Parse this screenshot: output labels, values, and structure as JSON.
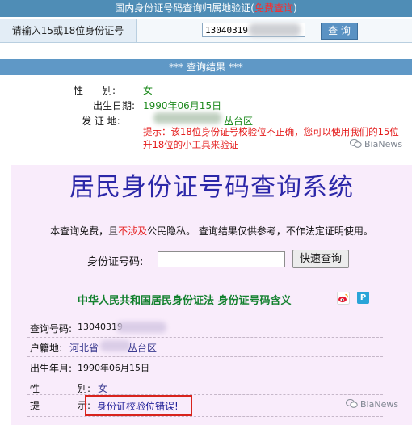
{
  "top_panel": {
    "title_prefix": "国内身份证号码查询归属地验证(",
    "title_badge": "免费查询",
    "title_suffix": ")",
    "input_label": "请输入15或18位身份证号",
    "input_value": "13040319",
    "query_button": "查 询",
    "result_bar": "*** 查询结果 ***",
    "gender_label": "性　　别:",
    "gender_value": "女",
    "birth_label": "出生日期:",
    "birth_value": "1990年06月15日",
    "issue_label": "发 证 地:",
    "issue_value_suffix": "丛台区",
    "hint_line1": "提示：该18位身份证号校验位不正确，您可以使用我们的15位",
    "hint_line2": "升18位的小工具来验证"
  },
  "watermark": {
    "text": "BiaNews"
  },
  "system": {
    "title": "居民身份证号码查询系统",
    "notice_a": "本查询免费，且",
    "notice_red": "不涉及",
    "notice_b": "公民隐私。 查询结果仅供参考，不作法定证明使用。",
    "id_label": "身份证号码:",
    "id_input_value": "",
    "search_button": "快速查询",
    "law_link": "中华人民共和国居民身份证法   身份证号码含义",
    "result": {
      "query_no_label": "查询号码:",
      "query_no_value": "13040319",
      "hukou_label": "户籍地:",
      "hukou_prefix": "河北省",
      "hukou_suffix": "丛台区",
      "birth_label": "出生年月:",
      "birth_value": "1990年06月15日",
      "gender_label_a": "性",
      "gender_label_b": "别:",
      "gender_value": "女",
      "hint_label_a": "提",
      "hint_label_b": "示:",
      "hint_value": "身份证校验位错误!"
    }
  },
  "colors": {
    "top_bar": "#4f8db6",
    "result_value_green": "#1d8a1d",
    "hint_red": "#e41b1b",
    "system_bg": "#f9ecfb",
    "system_title": "#2c27a8",
    "error_box": "#d8231d"
  },
  "icons": [
    "weibo-icon",
    "p-icon",
    "wechat-icon"
  ]
}
